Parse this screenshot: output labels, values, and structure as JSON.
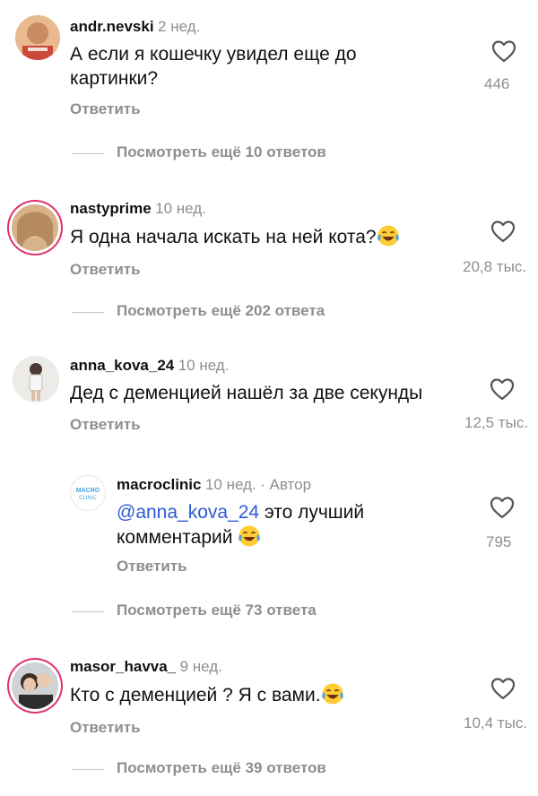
{
  "comments": [
    {
      "username": "andr.nevski",
      "time": "2 нед.",
      "text_line1": "А если я кошечку увидел еще до",
      "text_line2": "картинки?",
      "likes": "446",
      "reply_label": "Ответить",
      "view_more": "Посмотреть ещё 10 ответов"
    },
    {
      "username": "nastyprime",
      "time": "10 нед.",
      "text": "Я одна начала искать на ней кота?",
      "likes": "20,8 тыс.",
      "reply_label": "Ответить",
      "view_more": "Посмотреть ещё 202 ответа"
    },
    {
      "username": "anna_kova_24",
      "time": "10 нед.",
      "text": "Дед с деменцией нашёл за две секунды",
      "likes": "12,5 тыс.",
      "reply_label": "Ответить"
    },
    {
      "username": "macroclinic",
      "time": "10 нед.",
      "author_badge": "· Автор",
      "mention": "@anna_kova_24",
      "text_line1_rest": " это лучший",
      "text_line2": "комментарий",
      "likes": "795",
      "reply_label": "Ответить",
      "view_more": "Посмотреть ещё 73 ответа",
      "avatar_text_1": "MACRO",
      "avatar_text_2": "CLINIC"
    },
    {
      "username": "masor_havva_",
      "time": "9 нед.",
      "text": "Кто с деменцией ? Я с вами.",
      "likes": "10,4 тыс.",
      "reply_label": "Ответить",
      "view_more": "Посмотреть ещё 39 ответов"
    }
  ],
  "colors": {
    "mention": "#2d5bd3",
    "muted": "#8e8e8e",
    "story_ring": "#e1306c"
  },
  "icons": {
    "like": "heart-outline-icon",
    "emoji": "laughing-tears-emoji"
  }
}
